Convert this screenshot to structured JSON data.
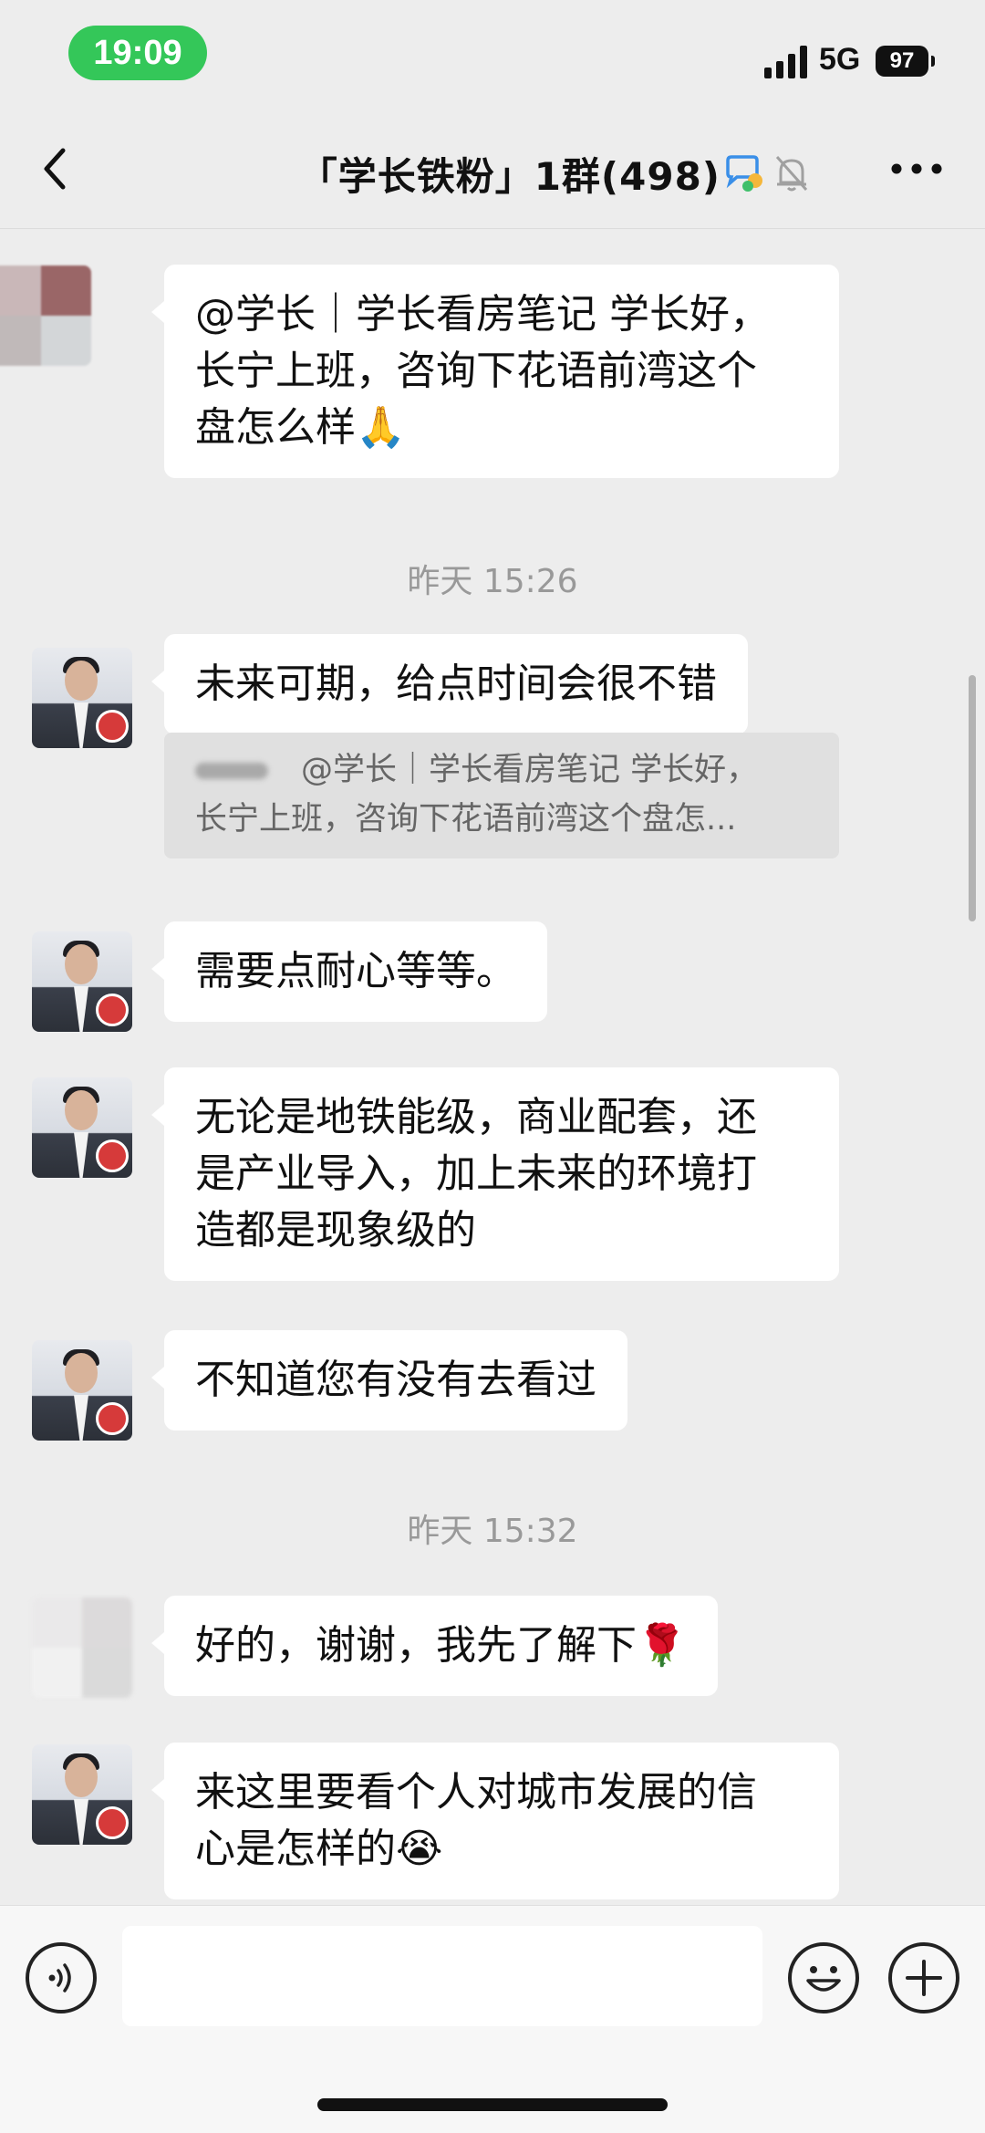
{
  "status_bar": {
    "time": "19:09",
    "network": "5G",
    "battery": "97"
  },
  "nav": {
    "title": "「学长铁粉」1群(498)"
  },
  "messages": [
    {
      "text_lines": [
        "@学长｜学长看房笔记 学长好，",
        "长宁上班，咨询下花语前湾这个",
        "盘怎么样🙏"
      ]
    },
    {
      "timestamp": "昨天 15:26"
    },
    {
      "text": "未来可期，给点时间会很不错",
      "quote_line1": "@学长｜学长看房笔记 学长好，",
      "quote_line2": "长宁上班，咨询下花语前湾这个盘怎..."
    },
    {
      "text": "需要点耐心等等。"
    },
    {
      "text_lines": [
        "无论是地铁能级，商业配套，还",
        "是产业导入，加上未来的环境打",
        "造都是现象级的"
      ]
    },
    {
      "text": "不知道您有没有去看过"
    },
    {
      "timestamp": "昨天 15:32"
    },
    {
      "text": "好的，谢谢，我先了解下🌹"
    },
    {
      "text_lines": [
        "来这里要看个人对城市发展的信",
        "心是怎样的😭"
      ]
    }
  ],
  "input": {
    "value": ""
  },
  "icons": {
    "back": "chevron-left-icon",
    "chat_bubble": "group-chat-icon",
    "mute": "bell-off-icon",
    "more": "more-dots-icon",
    "voice": "voice-icon",
    "emoji": "emoji-icon",
    "plus": "plus-icon"
  }
}
